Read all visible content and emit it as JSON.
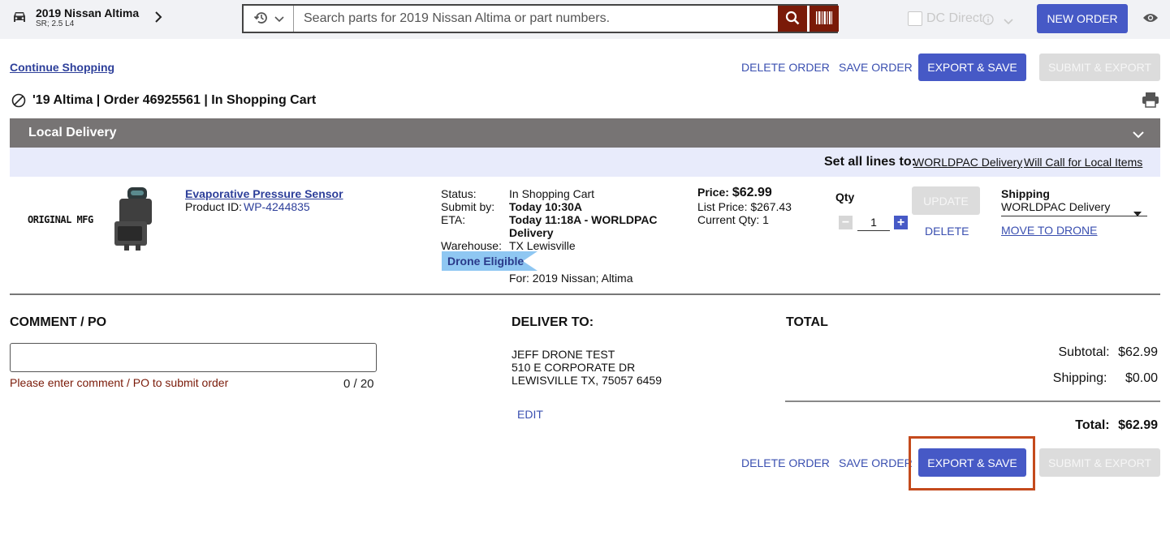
{
  "header": {
    "vehicle_title": "2019 Nissan Altima",
    "vehicle_sub": "SR; 2.5 L4",
    "search_placeholder": "Search parts for 2019 Nissan Altima or part numbers.",
    "dc_direct_label": "DC Direct",
    "new_order_label": "NEW ORDER"
  },
  "actions": {
    "continue_shopping": "Continue Shopping",
    "delete_order": "DELETE ORDER",
    "save_order": "SAVE ORDER",
    "export_save": "EXPORT & SAVE",
    "submit_export": "SUBMIT & EXPORT"
  },
  "order": {
    "title": "'19 Altima | Order 46925561 | In Shopping Cart"
  },
  "section": {
    "title": "Local Delivery",
    "set_all_label": "Set all lines to:",
    "set_all_opt1": "WORLDPAC Delivery",
    "set_all_opt2": "Will Call for Local Items"
  },
  "line_item": {
    "brand": "ORIGINAL MFG",
    "name": "Evaporative Pressure Sensor",
    "product_id_label": "Product ID:",
    "product_id": "WP-4244835",
    "status_label": "Status:",
    "status_value": "In Shopping Cart",
    "submit_label": "Submit by:",
    "submit_value": "Today 10:30A",
    "eta_label": "ETA:",
    "eta_value_line1": "Today 11:18A - WORLDPAC",
    "eta_value_line2": "Delivery",
    "warehouse_label": "Warehouse:",
    "warehouse_value": "TX Lewisville",
    "drone_badge": "Drone Eligible",
    "fitment": "For: 2019 Nissan; Altima",
    "price_label": "Price:",
    "price_value": "$62.99",
    "list_price": "List Price: $267.43",
    "current_qty": "Current Qty: 1",
    "qty_label": "Qty",
    "qty_value": "1",
    "update_label": "UPDATE",
    "delete_label": "DELETE",
    "shipping_label": "Shipping",
    "shipping_value": "WORLDPAC Delivery",
    "move_to_drone": "MOVE TO DRONE"
  },
  "comment": {
    "heading": "COMMENT / PO",
    "value": "",
    "error": "Please enter comment / PO to submit order",
    "counter": "0 / 20"
  },
  "deliver": {
    "heading": "DELIVER TO:",
    "line1": "JEFF DRONE TEST",
    "line2": "510 E CORPORATE DR",
    "line3": "LEWISVILLE TX, 75057 6459",
    "edit": "EDIT"
  },
  "total": {
    "heading": "TOTAL",
    "subtotal_label": "Subtotal:",
    "subtotal_value": "$62.99",
    "shipping_label": "Shipping:",
    "shipping_value": "$0.00",
    "total_label": "Total:",
    "total_value": "$62.99"
  },
  "colors": {
    "primary": "#4659c6",
    "dark_red": "#7a1a08",
    "highlight": "#c44a1c",
    "error_text": "#7a1a08"
  }
}
